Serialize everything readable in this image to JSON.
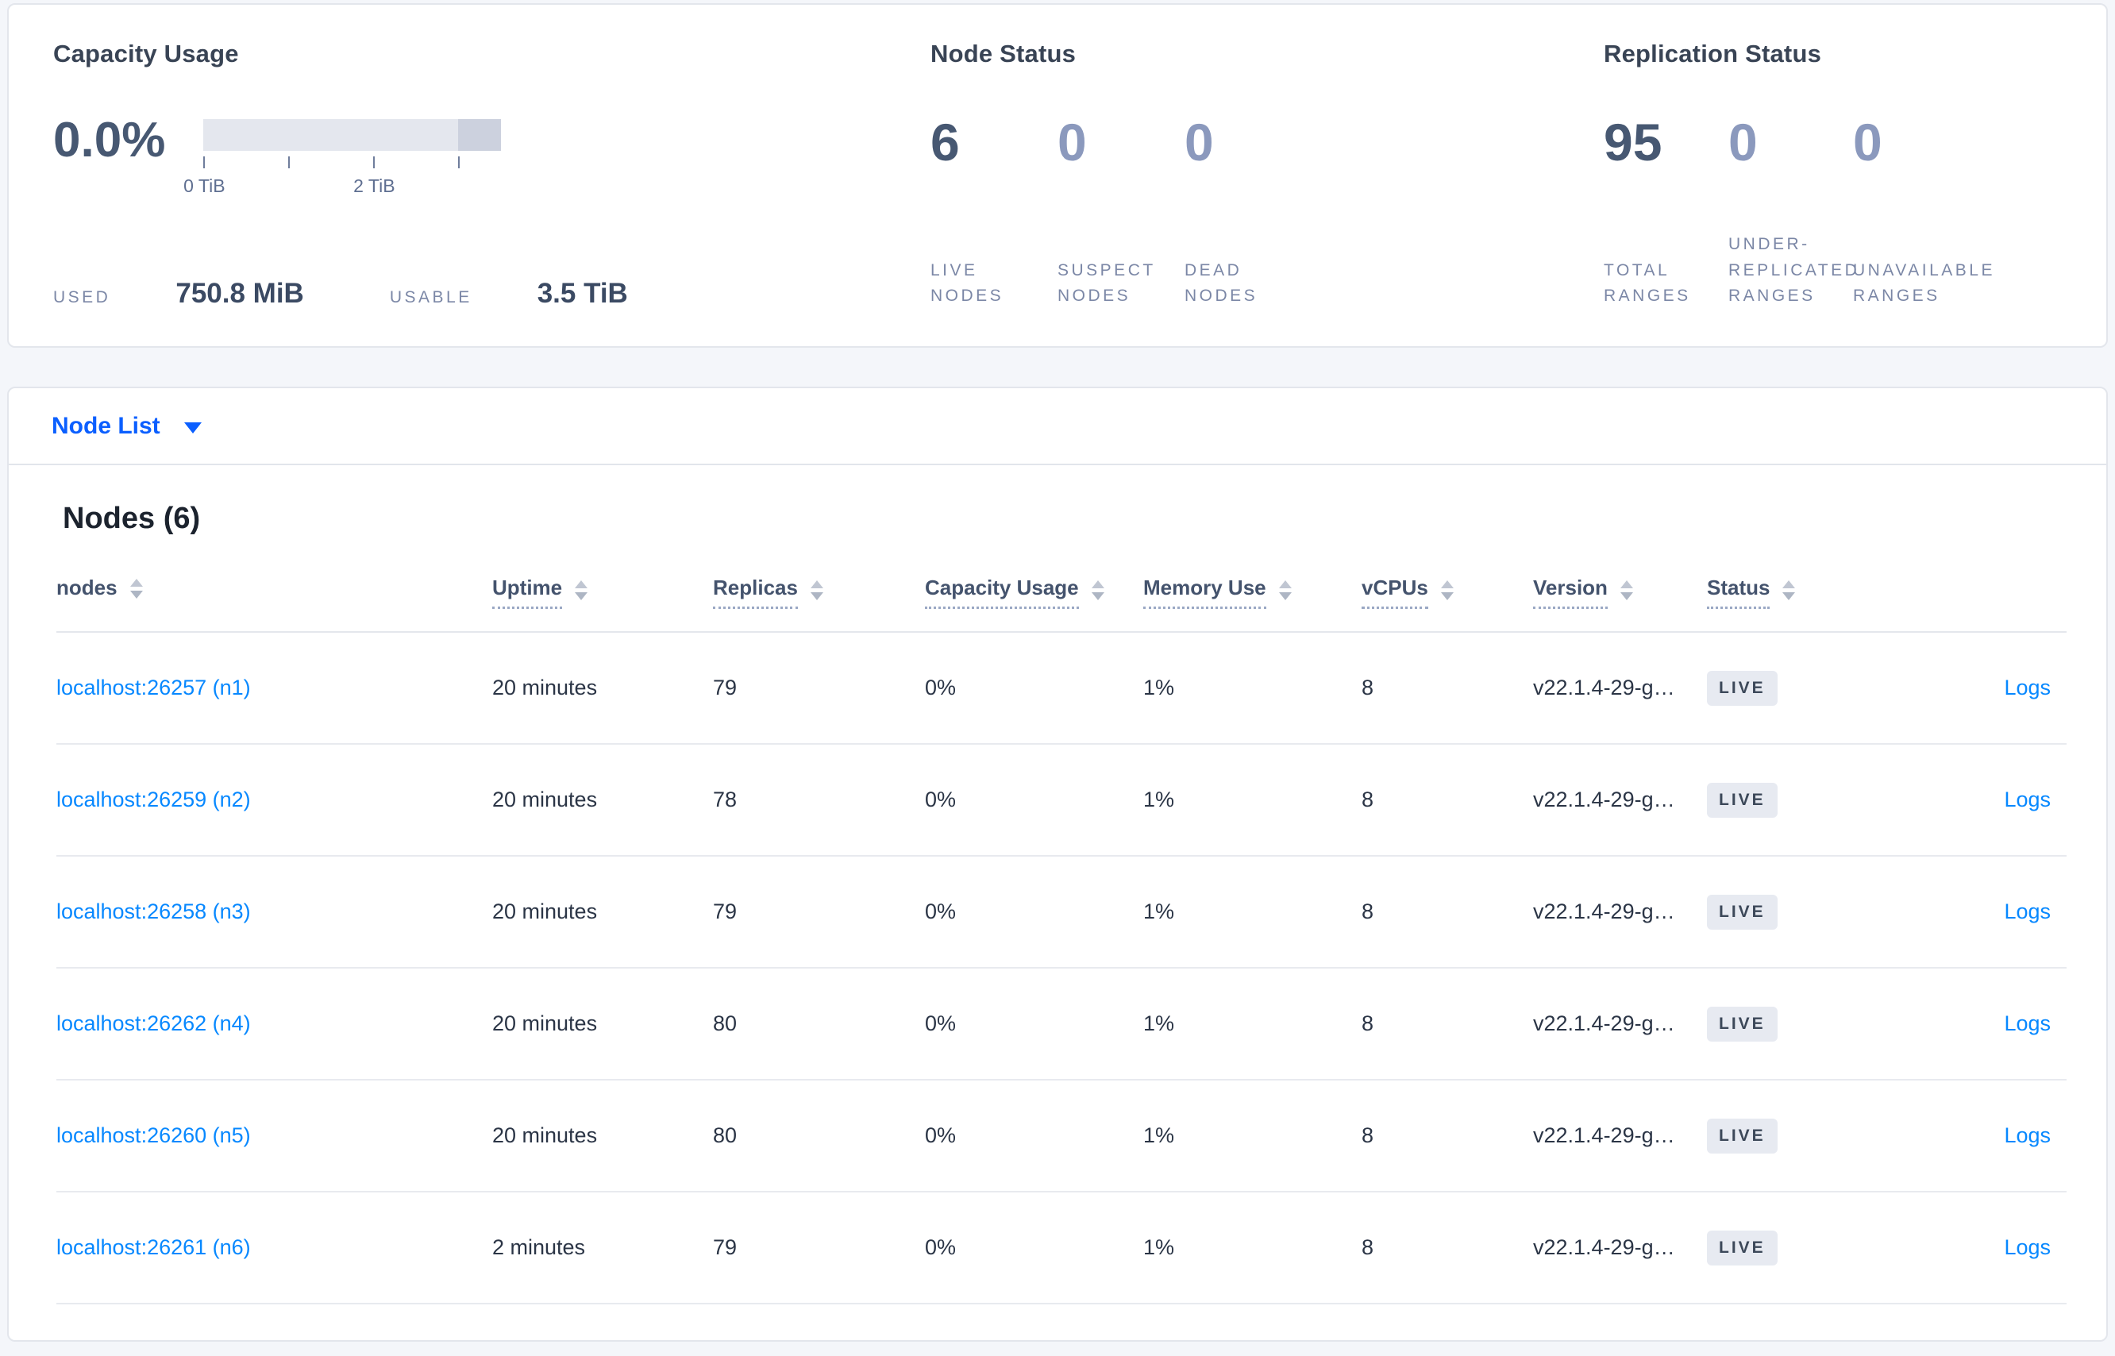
{
  "colors": {
    "page_bg": "#f4f6fa",
    "panel_border": "#e3e6ec",
    "heading": "#394455",
    "stat_primary": "#475872",
    "stat_muted": "#8b99bd",
    "stat_label": "#7b87a6",
    "selector_blue": "#0b5fff",
    "link_blue": "#0788ff",
    "cell_text": "#2b3546",
    "badge_bg": "#e7eaf1",
    "bar_track": "#e4e7ee",
    "bar_segment": "#ccd1de"
  },
  "summary": {
    "capacity": {
      "title": "Capacity Usage",
      "percent": "0.0%",
      "tick_labels": [
        "0 TiB",
        "2 TiB"
      ],
      "used_label": "USED",
      "used_value": "750.8 MiB",
      "usable_label": "USABLE",
      "usable_value": "3.5 TiB"
    },
    "node_status": {
      "title": "Node Status",
      "stats": [
        {
          "value": "6",
          "label": "LIVE NODES"
        },
        {
          "value": "0",
          "label": "SUSPECT NODES"
        },
        {
          "value": "0",
          "label": "DEAD NODES"
        }
      ]
    },
    "replication": {
      "title": "Replication Status",
      "stats": [
        {
          "value": "95",
          "label": "TOTAL RANGES"
        },
        {
          "value": "0",
          "label": "UNDER-REPLICATED RANGES"
        },
        {
          "value": "0",
          "label": "UNAVAILABLE RANGES"
        }
      ]
    }
  },
  "view_selector": {
    "label": "Node List"
  },
  "nodes_table": {
    "title": "Nodes (6)",
    "columns": [
      {
        "key": "node",
        "label": "nodes",
        "sortable": true,
        "underlined": false
      },
      {
        "key": "uptime",
        "label": "Uptime",
        "sortable": true,
        "underlined": true
      },
      {
        "key": "replicas",
        "label": "Replicas",
        "sortable": true,
        "underlined": true
      },
      {
        "key": "capacity",
        "label": "Capacity Usage",
        "sortable": true,
        "underlined": true
      },
      {
        "key": "memory",
        "label": "Memory Use",
        "sortable": true,
        "underlined": true
      },
      {
        "key": "vcpus",
        "label": "vCPUs",
        "sortable": true,
        "underlined": true
      },
      {
        "key": "version",
        "label": "Version",
        "sortable": true,
        "underlined": true
      },
      {
        "key": "status",
        "label": "Status",
        "sortable": true,
        "underlined": true
      },
      {
        "key": "logs",
        "label": "",
        "sortable": false,
        "underlined": false
      }
    ],
    "rows": [
      {
        "node": "localhost:26257 (n1)",
        "uptime": "20 minutes",
        "replicas": "79",
        "capacity": "0%",
        "memory": "1%",
        "vcpus": "8",
        "version": "v22.1.4-29-g…",
        "status": "LIVE",
        "logs": "Logs"
      },
      {
        "node": "localhost:26259 (n2)",
        "uptime": "20 minutes",
        "replicas": "78",
        "capacity": "0%",
        "memory": "1%",
        "vcpus": "8",
        "version": "v22.1.4-29-g…",
        "status": "LIVE",
        "logs": "Logs"
      },
      {
        "node": "localhost:26258 (n3)",
        "uptime": "20 minutes",
        "replicas": "79",
        "capacity": "0%",
        "memory": "1%",
        "vcpus": "8",
        "version": "v22.1.4-29-g…",
        "status": "LIVE",
        "logs": "Logs"
      },
      {
        "node": "localhost:26262 (n4)",
        "uptime": "20 minutes",
        "replicas": "80",
        "capacity": "0%",
        "memory": "1%",
        "vcpus": "8",
        "version": "v22.1.4-29-g…",
        "status": "LIVE",
        "logs": "Logs"
      },
      {
        "node": "localhost:26260 (n5)",
        "uptime": "20 minutes",
        "replicas": "80",
        "capacity": "0%",
        "memory": "1%",
        "vcpus": "8",
        "version": "v22.1.4-29-g…",
        "status": "LIVE",
        "logs": "Logs"
      },
      {
        "node": "localhost:26261 (n6)",
        "uptime": "2 minutes",
        "replicas": "79",
        "capacity": "0%",
        "memory": "1%",
        "vcpus": "8",
        "version": "v22.1.4-29-g…",
        "status": "LIVE",
        "logs": "Logs"
      }
    ]
  }
}
